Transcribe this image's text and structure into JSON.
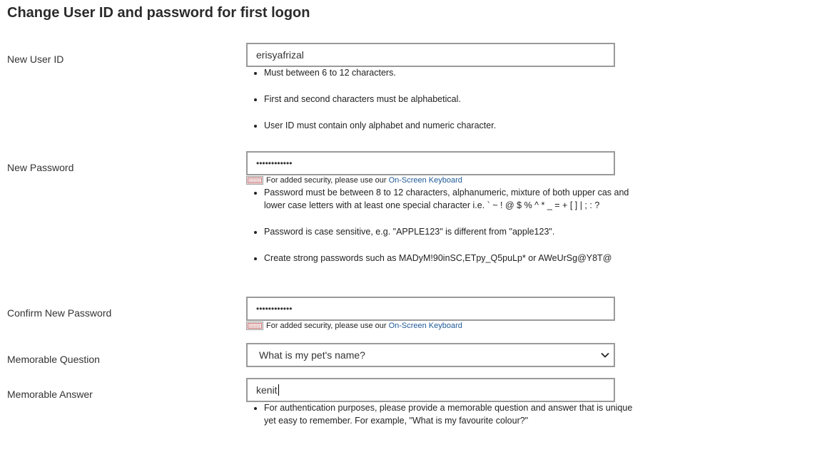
{
  "title": "Change User ID and password for first logon",
  "user_id": {
    "label": "New User ID",
    "value": "erisyafrizal",
    "hints": [
      "Must between 6 to 12 characters.",
      "First and second characters must be alphabetical.",
      "User ID must contain only alphabet and numeric character."
    ]
  },
  "new_password": {
    "label": "New Password",
    "value": "••••••••••••",
    "keyboard_note": "For added security, please use our",
    "keyboard_link": "On-Screen Keyboard",
    "hints": [
      "Password must be between 8 to 12 characters, alphanumeric, mixture of both upper cas and lower case letters with at least one special character i.e. ` ~ ! @ $ % ^ * _ = + [ ] | ; : ?",
      "Password is case sensitive, e.g. \"APPLE123\" is different from \"apple123\".",
      "Create strong passwords such as MADyM!90inSC,ETpy_Q5puLp* or AWeUrSg@Y8T@"
    ]
  },
  "confirm_password": {
    "label": "Confirm New Password",
    "value": "••••••••••••",
    "keyboard_note": "For added security, please use our",
    "keyboard_link": "On-Screen Keyboard"
  },
  "memorable_question": {
    "label": "Memorable Question",
    "selected": "What is my pet's name?"
  },
  "memorable_answer": {
    "label": "Memorable Answer",
    "value": "kenit",
    "hints": [
      "For authentication purposes, please provide a memorable question and answer that is unique yet easy to remember. For example, \"What is my favourite colour?\""
    ]
  }
}
